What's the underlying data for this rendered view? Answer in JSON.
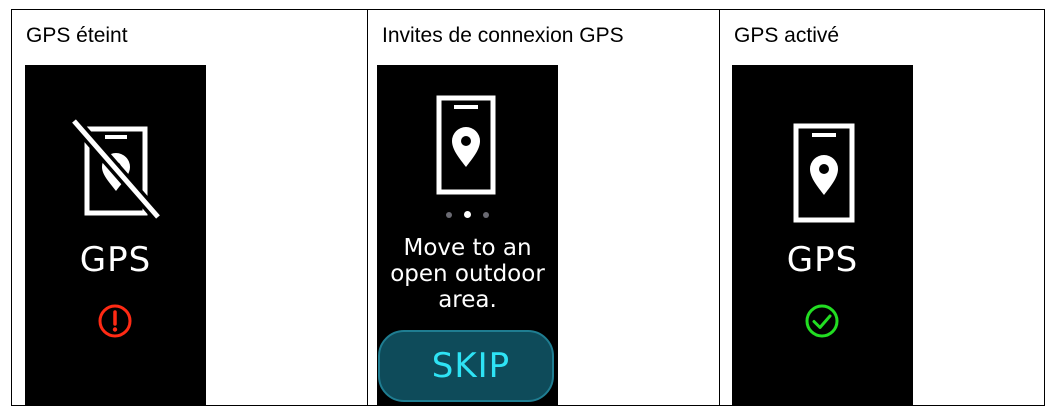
{
  "panels": [
    {
      "title": "GPS éteint",
      "status_label": "GPS",
      "phone_icon": "phone-gps-off-icon",
      "status_icon": "alert-circle-icon",
      "status_color": "#ff2a14"
    },
    {
      "title": "Invites de connexion GPS",
      "phone_icon": "phone-location-pin-icon",
      "pager": {
        "count": 3,
        "active_index": 1
      },
      "message_lines": [
        "Move to an",
        "open outdoor",
        "area."
      ],
      "skip_label": "SKIP",
      "button_color": "#0e4b5a",
      "button_text_color": "#2ee3f5"
    },
    {
      "title": "GPS activé",
      "status_label": "GPS",
      "phone_icon": "phone-location-pin-icon",
      "status_icon": "check-circle-icon",
      "status_color": "#22dd22"
    }
  ],
  "colors": {
    "screen_background": "#000000",
    "foreground": "#ffffff"
  }
}
